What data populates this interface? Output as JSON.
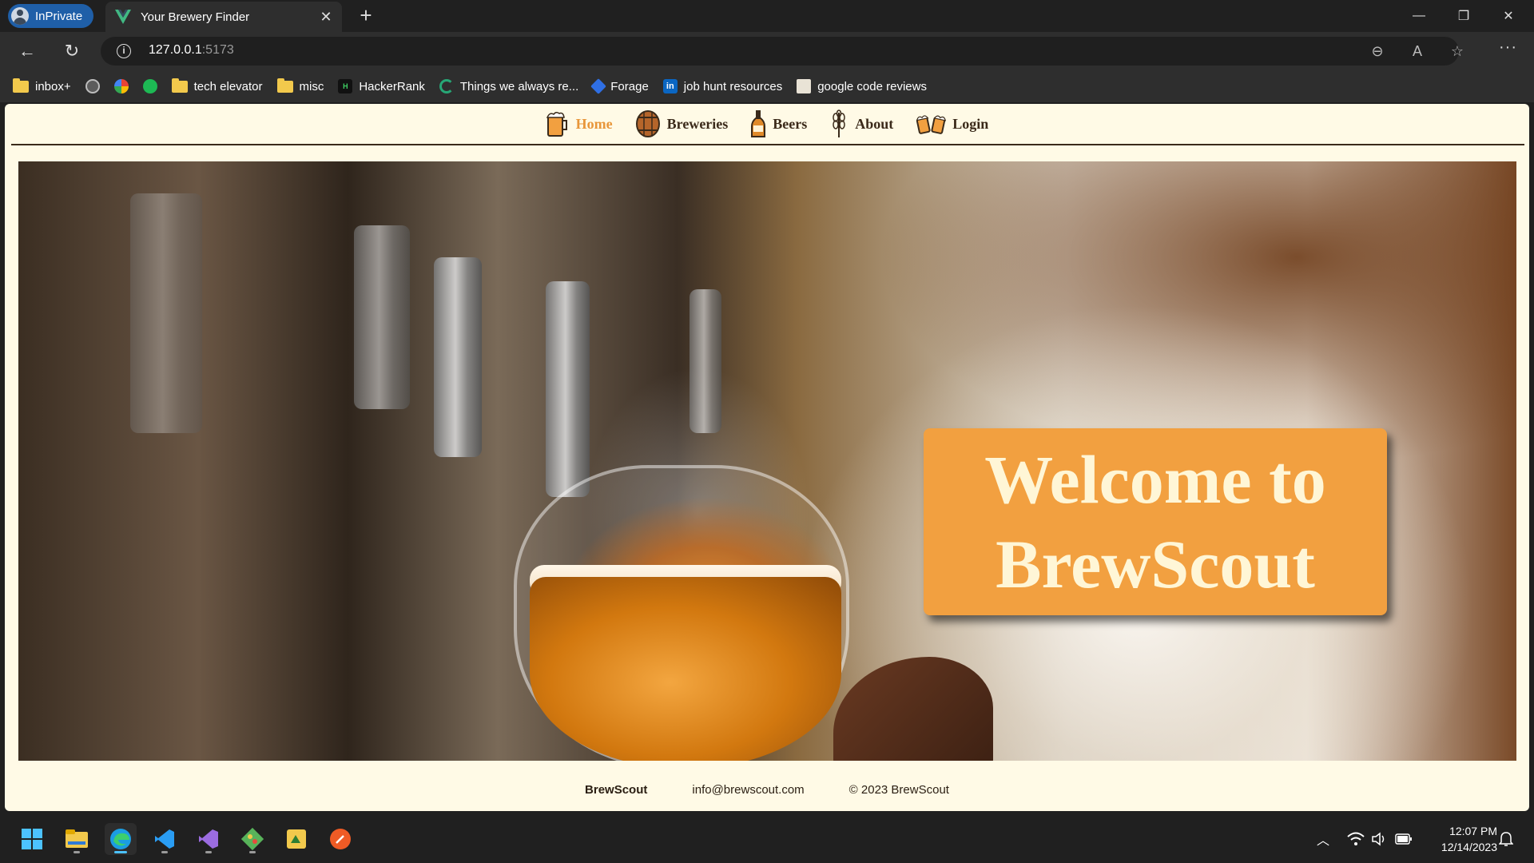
{
  "browser": {
    "inprivate_label": "InPrivate",
    "tab_title": "Your Brewery Finder",
    "url_host": "127.0.0.1",
    "url_port": ":5173"
  },
  "bookmarks": [
    {
      "icon": "folder-icon",
      "label": "inbox+"
    },
    {
      "icon": "chatgpt-icon",
      "label": ""
    },
    {
      "icon": "google-icon",
      "label": ""
    },
    {
      "icon": "spotify-icon",
      "label": ""
    },
    {
      "icon": "folder-icon",
      "label": "tech elevator"
    },
    {
      "icon": "folder-icon",
      "label": "misc"
    },
    {
      "icon": "hackerrank-icon",
      "label": "HackerRank"
    },
    {
      "icon": "things-icon",
      "label": "Things we always re..."
    },
    {
      "icon": "forage-icon",
      "label": "Forage"
    },
    {
      "icon": "linkedin-icon",
      "label": "job hunt resources"
    },
    {
      "icon": "bookmark-icon",
      "label": "google code reviews"
    }
  ],
  "site": {
    "nav": {
      "home": "Home",
      "breweries": "Breweries",
      "beers": "Beers",
      "about": "About",
      "login": "Login"
    },
    "hero": {
      "welcome_line1": "Welcome to",
      "welcome_line2": "BrewScout"
    },
    "footer": {
      "brand": "BrewScout",
      "email": "info@brewscout.com",
      "copyright": "© 2023 BrewScout"
    },
    "colors": {
      "page_bg": "#fffae6",
      "accent": "#f2a040",
      "active_nav": "#e8963a"
    }
  },
  "taskbar": {
    "time": "12:07 PM",
    "date": "12/14/2023"
  }
}
